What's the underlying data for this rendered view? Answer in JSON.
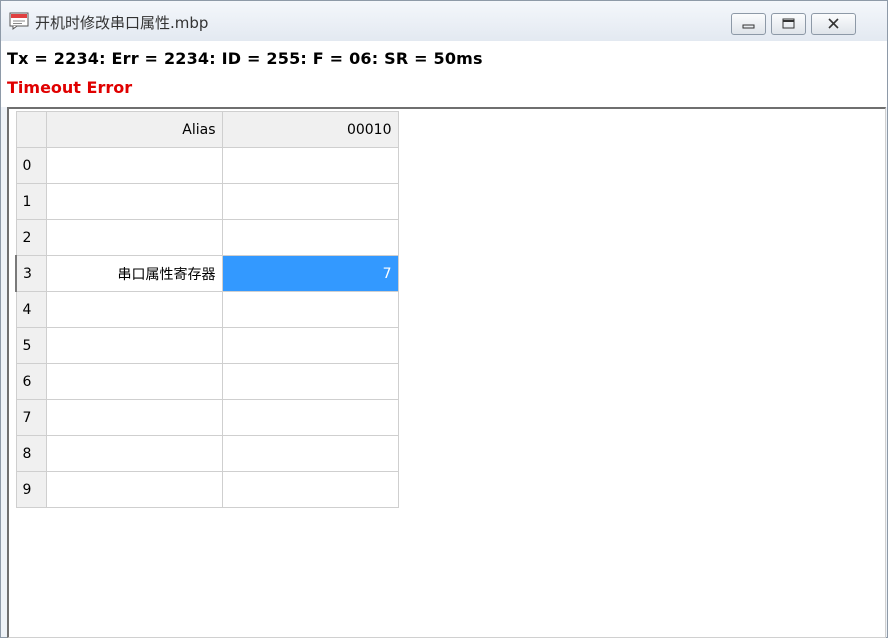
{
  "window": {
    "title": "开机时修改串口属性.mbp",
    "icon": "document-icon"
  },
  "status": {
    "stats_line": "Tx = 2234: Err = 2234: ID = 255: F = 06: SR = 50ms",
    "error_text": "Timeout Error",
    "error_color": "#e00000"
  },
  "table": {
    "alias_header": "Alias",
    "address_header": "00010",
    "rows": [
      {
        "index": "0",
        "alias": "",
        "value": ""
      },
      {
        "index": "1",
        "alias": "",
        "value": ""
      },
      {
        "index": "2",
        "alias": "",
        "value": ""
      },
      {
        "index": "3",
        "alias": "串口属性寄存器",
        "value": "7"
      },
      {
        "index": "4",
        "alias": "",
        "value": ""
      },
      {
        "index": "5",
        "alias": "",
        "value": ""
      },
      {
        "index": "6",
        "alias": "",
        "value": ""
      },
      {
        "index": "7",
        "alias": "",
        "value": ""
      },
      {
        "index": "8",
        "alias": "",
        "value": ""
      },
      {
        "index": "9",
        "alias": "",
        "value": ""
      }
    ],
    "selected_color": "#3399ff"
  }
}
